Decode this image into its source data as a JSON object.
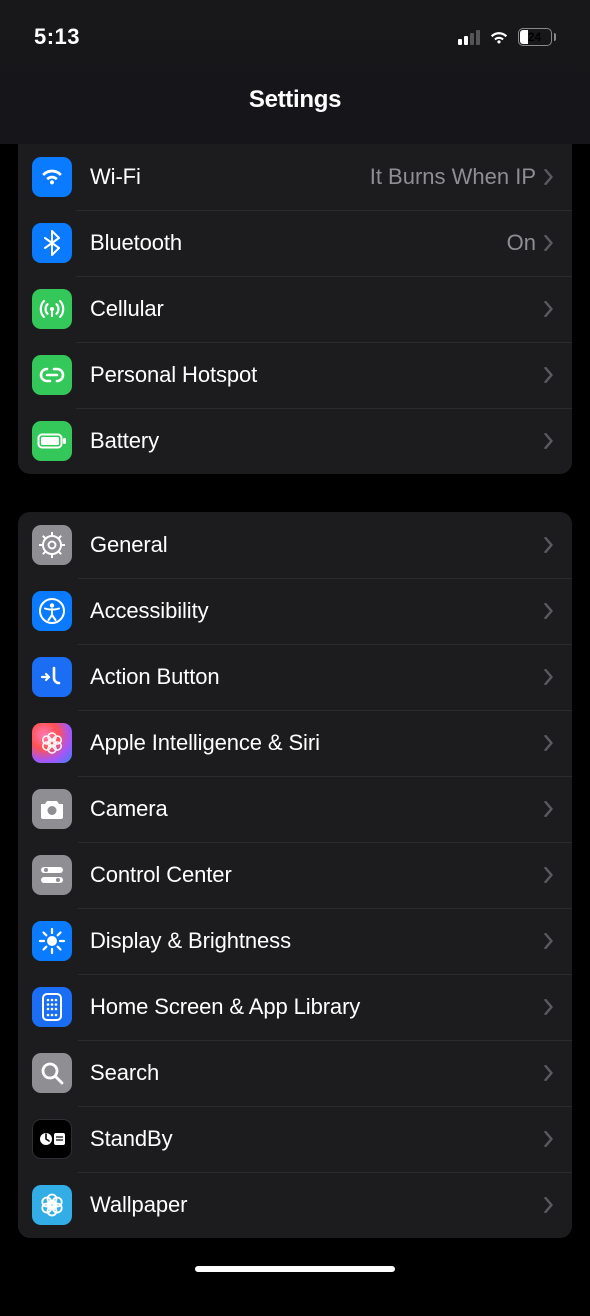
{
  "status": {
    "time": "5:13",
    "battery_pct": "24"
  },
  "header": {
    "title": "Settings"
  },
  "group1": [
    {
      "key": "wifi",
      "label": "Wi-Fi",
      "value": "It Burns When IP"
    },
    {
      "key": "bluetooth",
      "label": "Bluetooth",
      "value": "On"
    },
    {
      "key": "cellular",
      "label": "Cellular",
      "value": ""
    },
    {
      "key": "personal-hotspot",
      "label": "Personal Hotspot",
      "value": ""
    },
    {
      "key": "battery",
      "label": "Battery",
      "value": ""
    }
  ],
  "group2": [
    {
      "key": "general",
      "label": "General"
    },
    {
      "key": "accessibility",
      "label": "Accessibility"
    },
    {
      "key": "action-button",
      "label": "Action Button"
    },
    {
      "key": "apple-intel",
      "label": "Apple Intelligence & Siri"
    },
    {
      "key": "camera",
      "label": "Camera"
    },
    {
      "key": "control-center",
      "label": "Control Center"
    },
    {
      "key": "display",
      "label": "Display & Brightness"
    },
    {
      "key": "home-screen",
      "label": "Home Screen & App Library"
    },
    {
      "key": "search",
      "label": "Search"
    },
    {
      "key": "standby",
      "label": "StandBy"
    },
    {
      "key": "wallpaper",
      "label": "Wallpaper"
    }
  ]
}
